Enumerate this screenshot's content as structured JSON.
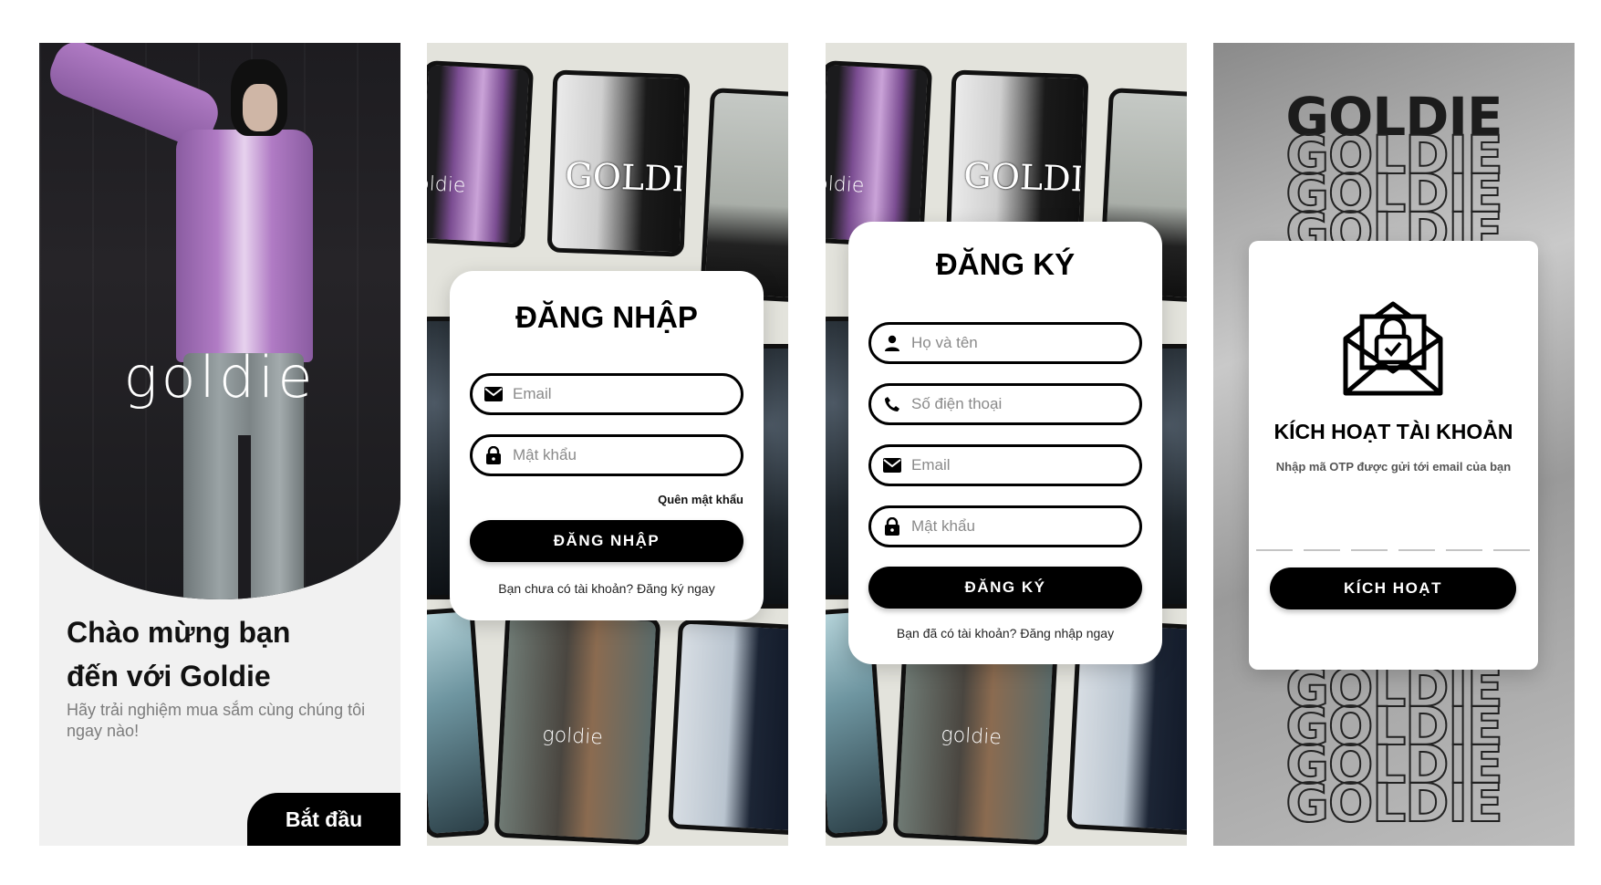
{
  "welcome": {
    "brand": "goldie",
    "title_line1": "Chào mừng bạn",
    "title_line2": "đến với Goldie",
    "subtitle": "Hãy trải nghiệm mua sắm cùng chúng tôi ngay nào!",
    "start_button": "Bắt đầu"
  },
  "collage": {
    "smoke_brand": "GOLDIE",
    "purple_brand": "oldie",
    "brown_brand": "goldie"
  },
  "login": {
    "title": "ĐĂNG NHẬP",
    "email_placeholder": "Email",
    "password_placeholder": "Mật khẩu",
    "forgot": "Quên mật khẩu",
    "button": "ĐĂNG NHẬP",
    "footer": "Bạn chưa có tài khoản? Đăng ký ngay"
  },
  "register": {
    "title": "ĐĂNG KÝ",
    "name_placeholder": "Họ và tên",
    "phone_placeholder": "Số điện thoại",
    "email_placeholder": "Email",
    "password_placeholder": "Mật khẩu",
    "button": "ĐĂNG KÝ",
    "footer": "Bạn đã có tài khoản? Đăng nhập ngay"
  },
  "activate": {
    "bg_word": "GOLDIE",
    "title": "KÍCH HOẠT TÀI KHOẢN",
    "subtitle": "Nhập mã OTP được gửi tới email của bạn",
    "button": "KÍCH HOẠT",
    "icon": "envelope-lock-icon"
  },
  "icons": {
    "email": "envelope-icon",
    "password": "lock-icon",
    "name": "person-icon",
    "phone": "phone-icon"
  },
  "colors": {
    "primary": "#000000",
    "card": "#ffffff",
    "welcome_bg": "#f1f1f1",
    "subtle_text": "#7c7c7c"
  }
}
